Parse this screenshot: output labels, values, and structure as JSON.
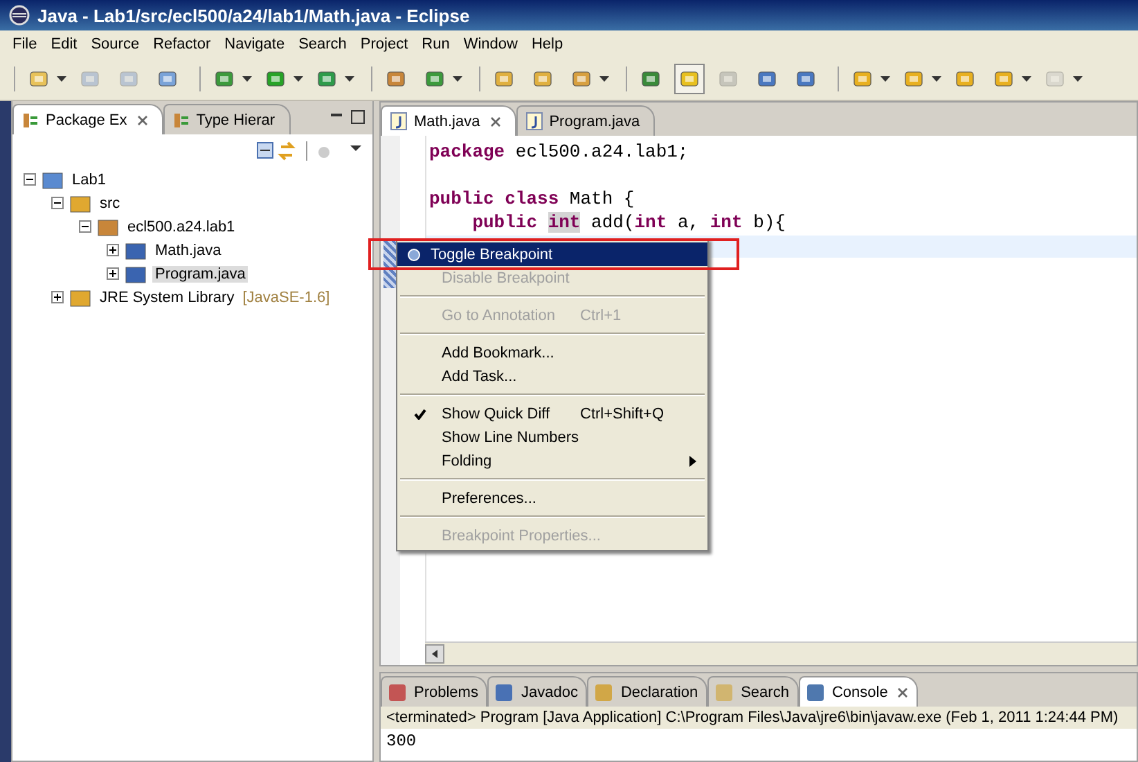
{
  "window": {
    "title": "Java - Lab1/src/ecl500/a24/lab1/Math.java - Eclipse"
  },
  "menu_bar": [
    "File",
    "Edit",
    "Source",
    "Refactor",
    "Navigate",
    "Search",
    "Project",
    "Run",
    "Window",
    "Help"
  ],
  "toolbar": [
    [
      {
        "dropdown": true,
        "disabled": false,
        "pressed": false
      },
      {
        "dropdown": false,
        "disabled": true,
        "pressed": false
      },
      {
        "dropdown": false,
        "disabled": true,
        "pressed": false
      },
      {
        "dropdown": false,
        "disabled": false,
        "pressed": false
      }
    ],
    [
      {
        "dropdown": true,
        "disabled": false,
        "pressed": false
      },
      {
        "dropdown": true,
        "disabled": false,
        "pressed": false
      },
      {
        "dropdown": true,
        "disabled": false,
        "pressed": false
      }
    ],
    [
      {
        "dropdown": false,
        "disabled": false,
        "pressed": false
      },
      {
        "dropdown": true,
        "disabled": false,
        "pressed": false
      }
    ],
    [
      {
        "dropdown": false,
        "disabled": false,
        "pressed": false
      },
      {
        "dropdown": false,
        "disabled": false,
        "pressed": false
      },
      {
        "dropdown": true,
        "disabled": false,
        "pressed": false
      }
    ],
    [
      {
        "dropdown": false,
        "disabled": false,
        "pressed": false
      },
      {
        "dropdown": false,
        "disabled": false,
        "pressed": true
      },
      {
        "dropdown": false,
        "disabled": true,
        "pressed": false
      },
      {
        "dropdown": false,
        "disabled": false,
        "pressed": false
      },
      {
        "dropdown": false,
        "disabled": false,
        "pressed": false
      }
    ],
    [
      {
        "dropdown": true,
        "disabled": false,
        "pressed": false
      },
      {
        "dropdown": true,
        "disabled": false,
        "pressed": false
      },
      {
        "dropdown": false,
        "disabled": false,
        "pressed": false
      },
      {
        "dropdown": true,
        "disabled": false,
        "pressed": false
      },
      {
        "dropdown": true,
        "disabled": true,
        "pressed": false
      }
    ]
  ],
  "left_panel": {
    "tabs": [
      {
        "label": "Package Ex",
        "selected": true
      },
      {
        "label": "Type Hierar",
        "selected": false
      }
    ],
    "tree": [
      {
        "label": "Lab1",
        "expanded": true,
        "selected": false,
        "children": [
          {
            "label": "src",
            "expanded": true,
            "selected": false,
            "children": [
              {
                "label": "ecl500.a24.lab1",
                "expanded": true,
                "selected": false,
                "children": [
                  {
                    "label": "Math.java",
                    "expanded": false,
                    "selected": false
                  },
                  {
                    "label": "Program.java",
                    "expanded": false,
                    "selected": true
                  }
                ]
              }
            ]
          },
          {
            "label": "JRE System Library",
            "suffix": "[JavaSE-1.6]",
            "expanded": false,
            "selected": false
          }
        ]
      }
    ]
  },
  "editor": {
    "tabs": [
      {
        "label": "Math.java",
        "selected": true
      },
      {
        "label": "Program.java",
        "selected": false
      }
    ],
    "lines": [
      {
        "kind": "code",
        "segments": [
          {
            "text": "package",
            "kind": "keyword"
          },
          {
            "text": " ecl500.a24.lab1;",
            "kind": "plain"
          }
        ]
      },
      {
        "kind": "blank"
      },
      {
        "kind": "code",
        "segments": [
          {
            "text": "public class",
            "kind": "keyword"
          },
          {
            "text": " Math {",
            "kind": "plain"
          }
        ]
      },
      {
        "kind": "code",
        "segments": [
          {
            "text": "    public ",
            "kind": "keyword"
          },
          {
            "text": "int",
            "kind": "occurrence"
          },
          {
            "text": " add(",
            "kind": "plain"
          },
          {
            "text": "int",
            "kind": "keyword"
          },
          {
            "text": " a, ",
            "kind": "plain"
          },
          {
            "text": "int",
            "kind": "keyword"
          },
          {
            "text": " b){",
            "kind": "plain"
          }
        ]
      }
    ]
  },
  "context_menu": [
    {
      "kind": "item",
      "label": "Toggle Breakpoint",
      "selected": true,
      "disabled": false,
      "checked": false,
      "submenu": false
    },
    {
      "kind": "item",
      "label": "Disable Breakpoint",
      "selected": false,
      "disabled": true,
      "checked": false,
      "submenu": false
    },
    {
      "kind": "separator"
    },
    {
      "kind": "item",
      "label": "Go to Annotation",
      "shortcut": "Ctrl+1",
      "selected": false,
      "disabled": true,
      "checked": false,
      "submenu": false
    },
    {
      "kind": "separator"
    },
    {
      "kind": "item",
      "label": "Add Bookmark...",
      "selected": false,
      "disabled": false,
      "checked": false,
      "submenu": false
    },
    {
      "kind": "item",
      "label": "Add Task...",
      "selected": false,
      "disabled": false,
      "checked": false,
      "submenu": false
    },
    {
      "kind": "separator"
    },
    {
      "kind": "item",
      "label": "Show Quick Diff",
      "shortcut": "Ctrl+Shift+Q",
      "selected": false,
      "disabled": false,
      "checked": true,
      "submenu": false
    },
    {
      "kind": "item",
      "label": "Show Line Numbers",
      "selected": false,
      "disabled": false,
      "checked": false,
      "submenu": false
    },
    {
      "kind": "item",
      "label": "Folding",
      "selected": false,
      "disabled": false,
      "checked": false,
      "submenu": true
    },
    {
      "kind": "separator"
    },
    {
      "kind": "item",
      "label": "Preferences...",
      "selected": false,
      "disabled": false,
      "checked": false,
      "submenu": false
    },
    {
      "kind": "separator"
    },
    {
      "kind": "item",
      "label": "Breakpoint Properties...",
      "selected": false,
      "disabled": true,
      "checked": false,
      "submenu": false
    }
  ],
  "bottom_panel": {
    "tabs": [
      {
        "label": "Problems",
        "selected": false
      },
      {
        "label": "Javadoc",
        "selected": false
      },
      {
        "label": "Declaration",
        "selected": false
      },
      {
        "label": "Search",
        "selected": false
      },
      {
        "label": "Console",
        "selected": true
      }
    ],
    "console_header": "<terminated> Program [Java Application] C:\\Program Files\\Java\\jre6\\bin\\javaw.exe (Feb 1, 2011 1:24:44 PM)",
    "output": "300"
  }
}
